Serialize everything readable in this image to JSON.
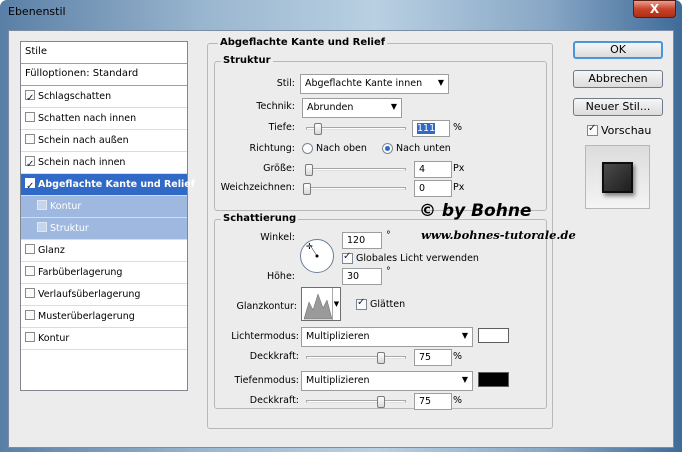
{
  "window": {
    "title": "Ebenenstil",
    "close_label": "X"
  },
  "styles_list": {
    "header": "Stile",
    "blend_options": "Fülloptionen: Standard",
    "items": [
      {
        "label": "Schlagschatten",
        "checked": true
      },
      {
        "label": "Schatten nach innen",
        "checked": false
      },
      {
        "label": "Schein nach außen",
        "checked": false
      },
      {
        "label": "Schein nach innen",
        "checked": true
      },
      {
        "label": "Abgeflachte Kante und Relief",
        "checked": true,
        "selected": true
      },
      {
        "label": "Kontur",
        "checked": false,
        "sub": true
      },
      {
        "label": "Struktur",
        "checked": false,
        "sub": true
      },
      {
        "label": "Glanz",
        "checked": false
      },
      {
        "label": "Farbüberlagerung",
        "checked": false
      },
      {
        "label": "Verlaufsüberlagerung",
        "checked": false
      },
      {
        "label": "Musterüberlagerung",
        "checked": false
      },
      {
        "label": "Kontur",
        "checked": false
      }
    ]
  },
  "bevel": {
    "group_title": "Abgeflachte Kante und Relief",
    "structure": {
      "title": "Struktur",
      "style_label": "Stil:",
      "style_value": "Abgeflachte Kante innen",
      "technique_label": "Technik:",
      "technique_value": "Abrunden",
      "depth_label": "Tiefe:",
      "depth_value": "111",
      "depth_unit": "%",
      "direction_label": "Richtung:",
      "direction_up": "Nach oben",
      "direction_down": "Nach unten",
      "size_label": "Größe:",
      "size_value": "4",
      "size_unit": "Px",
      "soften_label": "Weichzeichnen:",
      "soften_value": "0",
      "soften_unit": "Px"
    },
    "shading": {
      "title": "Schattierung",
      "angle_label": "Winkel:",
      "angle_value": "120",
      "angle_unit": "°",
      "global_light_label": "Globales Licht verwenden",
      "altitude_label": "Höhe:",
      "altitude_value": "30",
      "altitude_unit": "°",
      "gloss_label": "Glanzkontur:",
      "antialias_label": "Glätten",
      "highlight_mode_label": "Lichtermodus:",
      "highlight_mode_value": "Multiplizieren",
      "highlight_color": "#ffffff",
      "highlight_opacity_label": "Deckkraft:",
      "highlight_opacity_value": "75",
      "highlight_opacity_unit": "%",
      "shadow_mode_label": "Tiefenmodus:",
      "shadow_mode_value": "Multiplizieren",
      "shadow_color": "#000000",
      "shadow_opacity_label": "Deckkraft:",
      "shadow_opacity_value": "75",
      "shadow_opacity_unit": "%"
    }
  },
  "buttons": {
    "ok": "OK",
    "cancel": "Abbrechen",
    "new_style": "Neuer Stil...",
    "preview_label": "Vorschau"
  },
  "watermark": {
    "line1": "© by Bohne",
    "line2": "www.bohnes-tutorale.de"
  }
}
